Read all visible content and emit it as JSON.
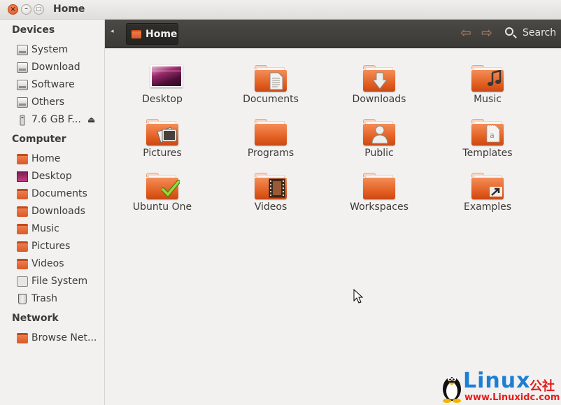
{
  "window": {
    "title": "Home"
  },
  "sidebar": {
    "sections": [
      {
        "heading": "Devices",
        "items": [
          {
            "label": "System",
            "icon": "hard-drive-icon"
          },
          {
            "label": "Download",
            "icon": "hard-drive-icon"
          },
          {
            "label": "Software",
            "icon": "hard-drive-icon"
          },
          {
            "label": "Others",
            "icon": "hard-drive-icon"
          },
          {
            "label": "7.6 GB F...",
            "icon": "usb-drive-icon",
            "eject": "⏏"
          }
        ]
      },
      {
        "heading": "Computer",
        "items": [
          {
            "label": "Home",
            "icon": "home-folder-icon"
          },
          {
            "label": "Desktop",
            "icon": "desktop-icon"
          },
          {
            "label": "Documents",
            "icon": "documents-folder-icon"
          },
          {
            "label": "Downloads",
            "icon": "downloads-folder-icon"
          },
          {
            "label": "Music",
            "icon": "music-folder-icon"
          },
          {
            "label": "Pictures",
            "icon": "pictures-folder-icon"
          },
          {
            "label": "Videos",
            "icon": "videos-folder-icon"
          },
          {
            "label": "File System",
            "icon": "file-system-icon"
          },
          {
            "label": "Trash",
            "icon": "trash-icon"
          }
        ]
      },
      {
        "heading": "Network",
        "items": [
          {
            "label": "Browse Net...",
            "icon": "network-folder-icon"
          }
        ]
      }
    ]
  },
  "toolbar": {
    "back_glyph": "◂",
    "location": "Home",
    "back_arrow": "⇦",
    "forward_arrow": "⇨",
    "search_label": "Search"
  },
  "content": {
    "items": [
      {
        "label": "Desktop",
        "icon": "desktop-icon"
      },
      {
        "label": "Documents",
        "icon": "documents-folder-icon"
      },
      {
        "label": "Downloads",
        "icon": "downloads-folder-icon"
      },
      {
        "label": "Music",
        "icon": "music-folder-icon"
      },
      {
        "label": "Pictures",
        "icon": "pictures-folder-icon"
      },
      {
        "label": "Programs",
        "icon": "folder-icon"
      },
      {
        "label": "Public",
        "icon": "public-folder-icon"
      },
      {
        "label": "Templates",
        "icon": "templates-folder-icon"
      },
      {
        "label": "Ubuntu One",
        "icon": "ubuntu-one-folder-icon"
      },
      {
        "label": "Videos",
        "icon": "videos-folder-icon"
      },
      {
        "label": "Workspaces",
        "icon": "folder-icon"
      },
      {
        "label": "Examples",
        "icon": "examples-folder-icon"
      }
    ]
  },
  "watermark": {
    "logo_text": "Linux",
    "cn_text": "公社",
    "url": "www.Linuxidc.com"
  },
  "colors": {
    "accent": "#e05a1c",
    "toolbar": "#3b3a37",
    "text": "#3c3b37",
    "watermark_blue": "#1c7fd4",
    "watermark_red": "#e21f1f"
  }
}
